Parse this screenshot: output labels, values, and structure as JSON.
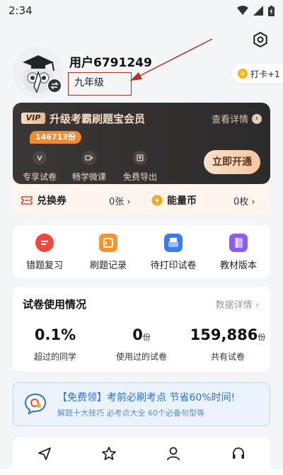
{
  "status_bar": {
    "time": "2:34"
  },
  "profile": {
    "username": "用户6791249",
    "grade": "九年级"
  },
  "checkin": {
    "label": "打卡+1"
  },
  "vip": {
    "badge": "VIP",
    "title": "升级考霸刷题宝会员",
    "details_label": "查看详情",
    "count_pill": "146713份",
    "features": [
      {
        "label": "专享试卷",
        "icon": "exam-icon"
      },
      {
        "label": "畅学微课",
        "icon": "video-icon"
      },
      {
        "label": "免费导出",
        "icon": "export-icon"
      }
    ],
    "open_label": "立即开通",
    "coupon": {
      "label": "兑换券",
      "value": "0张 ›"
    },
    "energy": {
      "label": "能量币",
      "value": "0枚 ›"
    }
  },
  "quick_actions": [
    {
      "label": "错题复习",
      "icon": "mistake-review-icon",
      "color": "#f0483e"
    },
    {
      "label": "刷题记录",
      "icon": "practice-record-icon",
      "color": "#f79328"
    },
    {
      "label": "待打印试卷",
      "icon": "print-paper-icon",
      "color": "#3a7bf0"
    },
    {
      "label": "教材版本",
      "icon": "textbook-icon",
      "color": "#8b5cf0"
    }
  ],
  "stats": {
    "title": "试卷使用情况",
    "link": "数据详情 ›",
    "items": [
      {
        "value": "0.1%",
        "unit": "",
        "caption": "超过的同学"
      },
      {
        "value": "0",
        "unit": "份",
        "caption": "使用过的试卷"
      },
      {
        "value": "159,886",
        "unit": "份",
        "caption": "共有试卷"
      }
    ]
  },
  "promo": {
    "title": "【免费领】考前必刷考点 节省60%时间!",
    "subtitle": "解题十大技巧 必考点大全 60个必备句型等"
  },
  "bottom_icons": [
    "share-icon",
    "star-icon",
    "user-icon",
    "headset-icon"
  ],
  "colors": {
    "accent_blue": "#2b6fd6",
    "vip_dark": "#2c2b2b",
    "annotation_red": "#b3322a"
  }
}
